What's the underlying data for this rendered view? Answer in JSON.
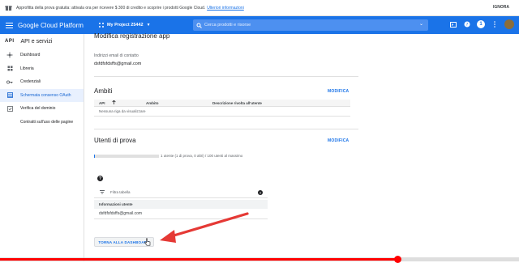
{
  "promo": {
    "text": "Approfitta della prova gratuita: attivala ora per ricevere $ 300 di credito e scoprire i prodotti Google Cloud.",
    "link": "Ulteriori informazioni",
    "dismiss": "IGNORA"
  },
  "topbar": {
    "brand": "Google Cloud Platform",
    "project": "My Project 25442",
    "search_placeholder": "Cerca prodotti e risorse",
    "avatar_initial": "1"
  },
  "sidebar": {
    "logo": "API",
    "title": "API e servizi",
    "items": [
      {
        "label": "Dashboard",
        "icon": "dashboard-icon"
      },
      {
        "label": "Libreria",
        "icon": "library-icon"
      },
      {
        "label": "Credenziali",
        "icon": "key-icon"
      },
      {
        "label": "Schermata consenso OAuth",
        "icon": "oauth-icon",
        "active": true
      },
      {
        "label": "Verifica del dominio",
        "icon": "checkbox-icon"
      },
      {
        "label": "Contratti sull'uso delle pagine",
        "icon": ""
      }
    ]
  },
  "main": {
    "heading": "Modifica registrazione app",
    "contact_label": "Indirizzi email di contatto",
    "contact_value": "dsfdfsfdsffs@gmail.com",
    "scopes": {
      "title": "Ambiti",
      "edit": "MODIFICA",
      "columns": [
        "API",
        "Ambito",
        "Descrizione rivolta all'utente"
      ],
      "empty": "Nessuna riga da visualizzare"
    },
    "test_users": {
      "title": "Utenti di prova",
      "edit": "MODIFICA",
      "progress_text": "1 utente (1 di prova, 0 altri) / 100 utenti al massimo",
      "progress_fraction": 0.01,
      "filter_placeholder": "Filtra tabella",
      "column": "Informazioni utente",
      "rows": [
        "dsfdfsfdsffs@gmail.com"
      ]
    },
    "back_button": "TORNA ALLA DASHBOARD"
  },
  "video": {
    "played_fraction": 0.766
  },
  "colors": {
    "accent": "#1a73e8",
    "annotation": "#e53935",
    "player": "#ff0000"
  }
}
